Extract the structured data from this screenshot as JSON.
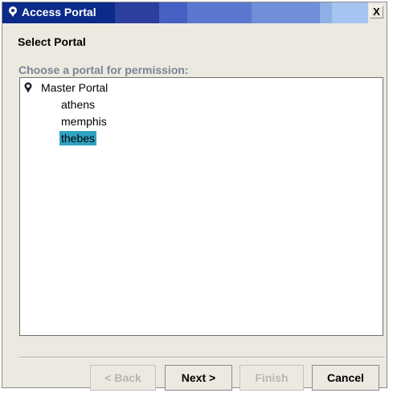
{
  "window": {
    "title": "Access Portal",
    "close_label": "X"
  },
  "page": {
    "subtitle": "Select Portal",
    "prompt": "Choose a portal for permission:"
  },
  "tree": {
    "root": {
      "label": "Master Portal",
      "icon": "portal-pin-icon"
    },
    "children": [
      {
        "label": "athens",
        "selected": false
      },
      {
        "label": "memphis",
        "selected": false
      },
      {
        "label": "thebes",
        "selected": true
      }
    ]
  },
  "buttons": {
    "back": {
      "label": "< Back",
      "enabled": false
    },
    "next": {
      "label": "Next >",
      "enabled": true
    },
    "finish": {
      "label": "Finish",
      "enabled": false
    },
    "cancel": {
      "label": "Cancel",
      "enabled": true
    }
  },
  "colors": {
    "selection": "#2fa2c2",
    "titlebar": "#0b2a8a",
    "prompt_text": "#7b8496"
  }
}
